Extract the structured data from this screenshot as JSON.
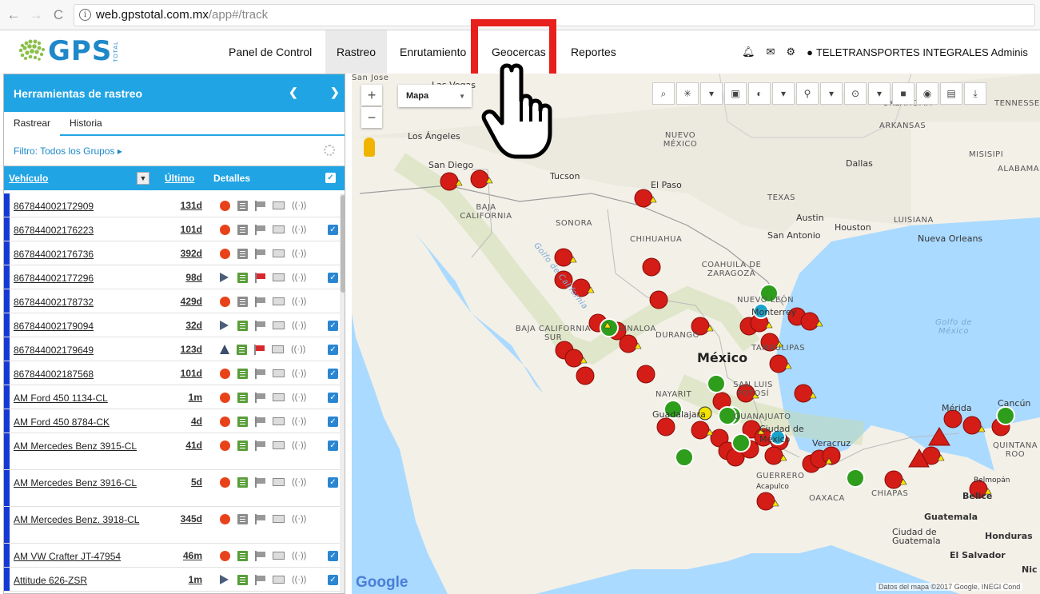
{
  "browser": {
    "url_host": "web.gpstotal.com.mx",
    "url_path": "/app#/track"
  },
  "app": {
    "logo_text": "GPS",
    "logo_sub": "TOTAL",
    "menu": [
      "Panel de Control",
      "Rastreo",
      "Enrutamiento",
      "Geocercas",
      "Reportes"
    ],
    "active_menu": "Rastreo",
    "highlighted_menu": "Geocercas",
    "account": "TELETRANSPORTES INTEGRALES Adminis"
  },
  "panel": {
    "title": "Herramientas de rastreo",
    "tabs": [
      "Rastrear",
      "Historia"
    ],
    "filter": "Filtro: Todos los Grupos ▸",
    "columns": {
      "vehicle": "Vehículo",
      "last": "Último",
      "details": "Detalles"
    },
    "rows": [
      {
        "vehicle": "867844002172909",
        "last": "131d",
        "status": "stopped",
        "doc": "gray",
        "flag": "gray",
        "checked": false
      },
      {
        "vehicle": "867844002176223",
        "last": "101d",
        "status": "stopped",
        "doc": "gray",
        "flag": "gray",
        "checked": true
      },
      {
        "vehicle": "867844002176736",
        "last": "392d",
        "status": "stopped",
        "doc": "gray",
        "flag": "gray",
        "checked": false
      },
      {
        "vehicle": "867844002177296",
        "last": "98d",
        "status": "moving-right",
        "doc": "green",
        "flag": "red",
        "checked": true
      },
      {
        "vehicle": "867844002178732",
        "last": "429d",
        "status": "stopped",
        "doc": "gray",
        "flag": "gray",
        "checked": false
      },
      {
        "vehicle": "867844002179094",
        "last": "32d",
        "status": "moving-right",
        "doc": "green",
        "flag": "gray",
        "checked": true
      },
      {
        "vehicle": "867844002179649",
        "last": "123d",
        "status": "moving-up",
        "doc": "green",
        "flag": "red",
        "checked": true
      },
      {
        "vehicle": "867844002187568",
        "last": "101d",
        "status": "stopped",
        "doc": "green",
        "flag": "gray",
        "checked": true
      },
      {
        "vehicle": "AM Ford 450 1134-CL",
        "last": "1m",
        "status": "stopped",
        "doc": "green",
        "flag": "gray",
        "checked": true
      },
      {
        "vehicle": "AM Ford 450 8784-CK",
        "last": "4d",
        "status": "stopped",
        "doc": "green",
        "flag": "gray",
        "checked": true
      },
      {
        "vehicle": "AM Mercedes Benz 3915-CL",
        "last": "41d",
        "status": "stopped",
        "doc": "green",
        "flag": "gray",
        "checked": true
      },
      {
        "vehicle": "AM Mercedes Benz 3916-CL",
        "last": "5d",
        "status": "stopped",
        "doc": "green",
        "flag": "gray",
        "checked": true
      },
      {
        "vehicle": "AM Mercedes Benz. 3918-CL",
        "last": "345d",
        "status": "stopped",
        "doc": "gray",
        "flag": "gray",
        "checked": false
      },
      {
        "vehicle": "AM VW Crafter JT-47954",
        "last": "46m",
        "status": "stopped",
        "doc": "green",
        "flag": "gray",
        "checked": true
      },
      {
        "vehicle": "Attitude 626-ZSR",
        "last": "1m",
        "status": "moving-right",
        "doc": "green",
        "flag": "gray",
        "checked": true
      }
    ]
  },
  "map": {
    "type": "Mapa",
    "labels": [
      "San Jose",
      "Las Vegas",
      "Los Ángeles",
      "San Diego",
      "Tucson",
      "El Paso",
      "NUEVO MÉXICO",
      "ARKANSAS",
      "MISISIPI",
      "ALABAMA",
      "Dallas",
      "TEXAS",
      "Austin",
      "Houston",
      "LUISIANA",
      "San Antonio",
      "Nueva Orleans",
      "BAJA CALIFORNIA",
      "SONORA",
      "CHIHUAHUA",
      "COAHUILA DE ZARAGOZA",
      "NUEVO LEÓN",
      "Monterrey",
      "Golfo de México",
      "Golfo de California",
      "BAJA CALIFORNIA SUR",
      "DURANGO",
      "SINALOA",
      "TAMAULIPAS",
      "México",
      "NAYARIT",
      "SAN LUIS POTOSÍ",
      "Guadalajara",
      "GUANAJUATO",
      "Ciudad de México",
      "Veracruz",
      "GUERRERO",
      "Acapulco",
      "OAXACA",
      "CHIAPAS",
      "Mérida",
      "Cancún",
      "QUINTANA ROO",
      "Belmopán",
      "Belice",
      "Guatemala",
      "Ciudad de Guatemala",
      "Honduras",
      "El Salvador",
      "Nic",
      "OKLAHOMA",
      "TENNESSEE"
    ],
    "attribution": "Datos del mapa ©2017 Google, INEGI  Cond",
    "google": "Google"
  }
}
